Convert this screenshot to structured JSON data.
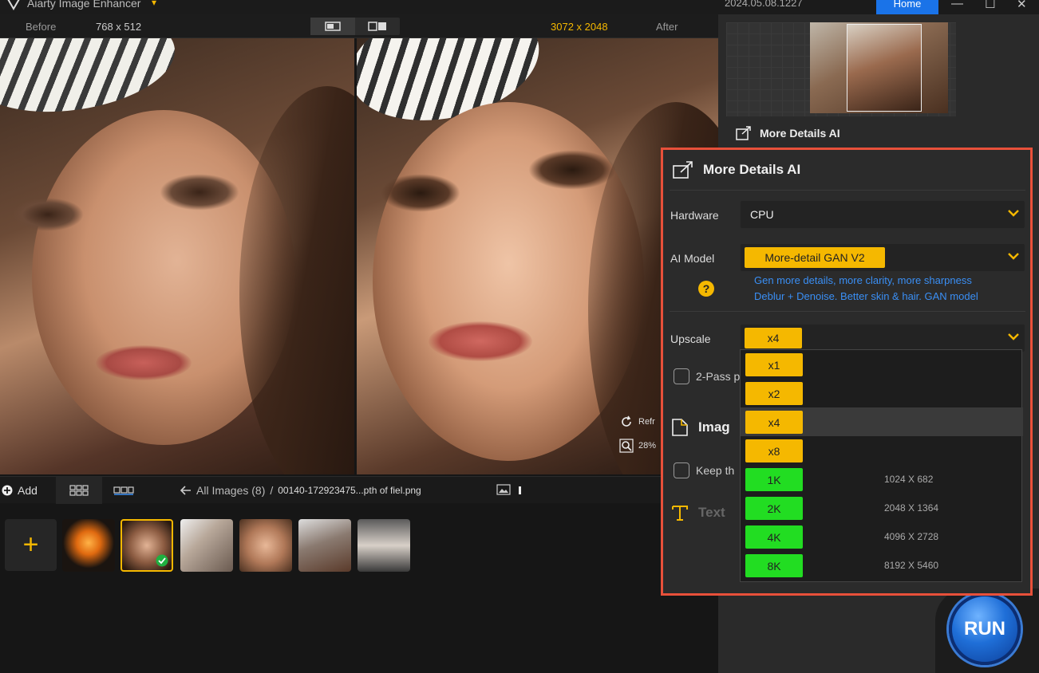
{
  "app": {
    "title": "Aiarty Image Enhancer",
    "version": "2024.05.08.1227",
    "home_label": "Home"
  },
  "compare": {
    "before_label": "Before",
    "before_res": "768 x 512",
    "after_res": "3072 x 2048",
    "after_label": "After"
  },
  "side": {
    "refresh_label": "Refr",
    "zoom_label": "28%"
  },
  "bottom": {
    "add_label": "Add",
    "breadcrumb": "All Images (8)",
    "sep": "/",
    "filename": "00140-172923475...pth of fiel.png"
  },
  "right": {
    "section_label": "More Details AI"
  },
  "panel": {
    "title": "More Details AI",
    "hardware_label": "Hardware",
    "hardware_value": "CPU",
    "model_label": "AI Model",
    "model_value": "More-detail GAN V2",
    "desc1": "Gen more details, more clarity, more sharpness",
    "desc2": "Deblur + Denoise. Better skin & hair. GAN model",
    "upscale_label": "Upscale",
    "upscale_value": "x4",
    "twopass_label": "2-Pass p",
    "image_label": "Imag",
    "keep_label": "Keep th",
    "text_label": "Text",
    "help": "?"
  },
  "dropdown": [
    {
      "label": "x1",
      "kind": "y",
      "res": ""
    },
    {
      "label": "x2",
      "kind": "y",
      "res": ""
    },
    {
      "label": "x4",
      "kind": "y",
      "res": ""
    },
    {
      "label": "x8",
      "kind": "y",
      "res": ""
    },
    {
      "label": "1K",
      "kind": "g",
      "res": "1024 X 682"
    },
    {
      "label": "2K",
      "kind": "g",
      "res": "2048 X 1364"
    },
    {
      "label": "4K",
      "kind": "g",
      "res": "4096 X 2728"
    },
    {
      "label": "8K",
      "kind": "g",
      "res": "8192 X 5460"
    }
  ],
  "run_label": "RUN",
  "colors": {
    "accent": "#f5b800",
    "highlight": "#e8503a",
    "link": "#3a8ff5",
    "green": "#22dd22",
    "blue": "#1a73e8"
  }
}
